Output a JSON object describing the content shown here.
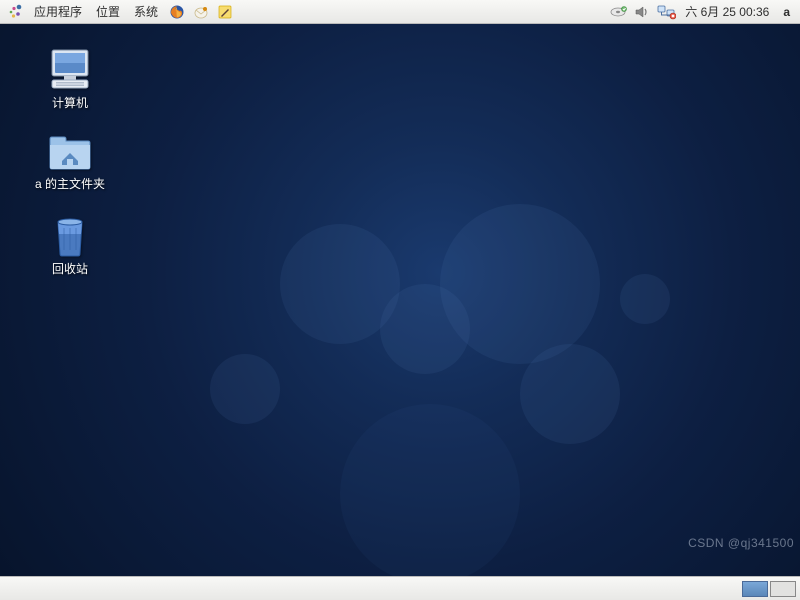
{
  "top_panel": {
    "menus": {
      "applications": "应用程序",
      "places": "位置",
      "system": "系统"
    },
    "clock": "六 6月 25 00:36",
    "user": "a"
  },
  "desktop_icons": {
    "computer": "计算机",
    "home": "a 的主文件夹",
    "trash": "回收站"
  },
  "watermark": "CSDN @qj341500"
}
